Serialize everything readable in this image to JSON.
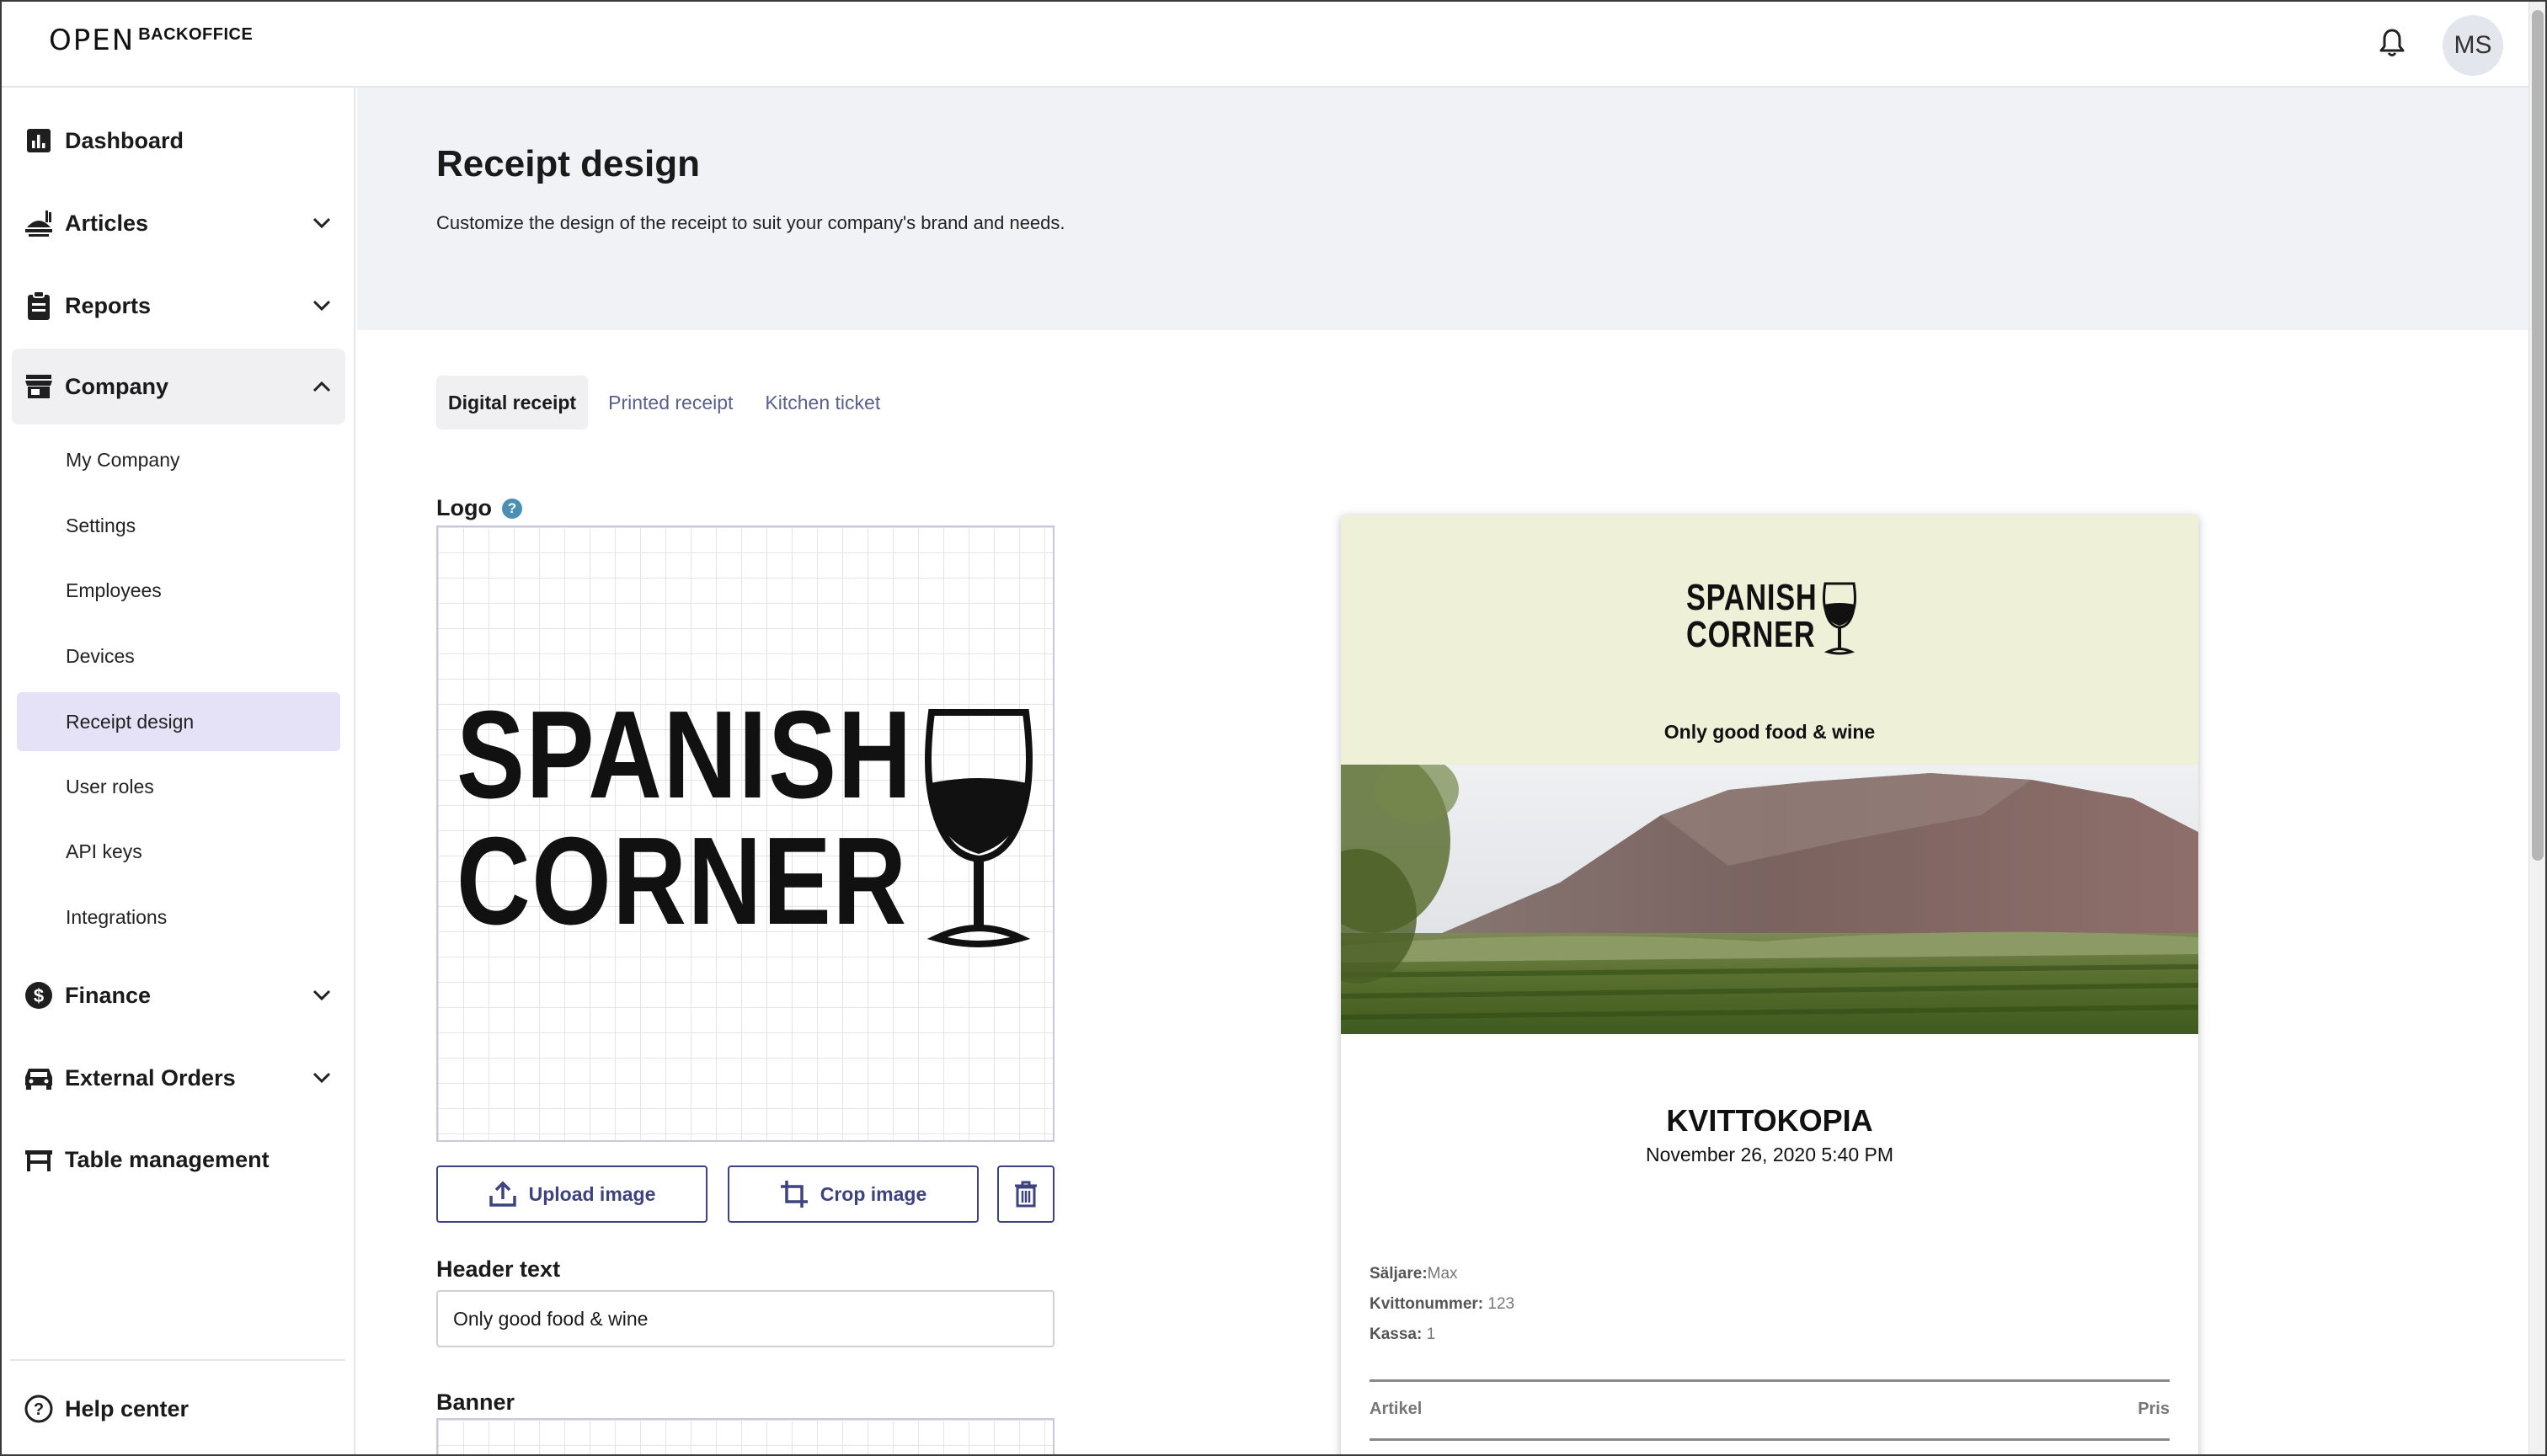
{
  "app": {
    "brand_main": "OPEN",
    "brand_sub": "BACKOFFICE",
    "user_initials": "MS"
  },
  "sidebar": {
    "items": [
      {
        "label": "Dashboard",
        "icon": "bar-chart-icon"
      },
      {
        "label": "Articles",
        "icon": "food-icon"
      },
      {
        "label": "Reports",
        "icon": "clipboard-icon"
      },
      {
        "label": "Company",
        "icon": "store-icon"
      },
      {
        "label": "Finance",
        "icon": "dollar-icon"
      },
      {
        "label": "External Orders",
        "icon": "car-icon"
      },
      {
        "label": "Table management",
        "icon": "table-icon"
      }
    ],
    "company_sub": [
      "My Company",
      "Settings",
      "Employees",
      "Devices",
      "Receipt design",
      "User roles",
      "API keys",
      "Integrations"
    ],
    "active_sub": "Receipt design",
    "help": "Help center"
  },
  "page": {
    "title": "Receipt design",
    "description": "Customize the design of the receipt to suit your company's brand and needs."
  },
  "tabs": [
    "Digital receipt",
    "Printed receipt",
    "Kitchen ticket"
  ],
  "active_tab": "Digital receipt",
  "form": {
    "logo_label": "Logo",
    "logo_help": "?",
    "logo_text_line1": "SPANISH",
    "logo_text_line2": "CORNER",
    "upload_label": "Upload image",
    "crop_label": "Crop image",
    "header_label": "Header text",
    "header_value": "Only good food & wine",
    "banner_label": "Banner"
  },
  "receipt": {
    "logo_line1": "SPANISH",
    "logo_line2": "CORNER",
    "tagline": "Only good food & wine",
    "title": "KVITTOKOPIA",
    "date": "November 26, 2020 5:40 PM",
    "seller_label": "Säljare:",
    "seller_value": "Max",
    "receipt_no_label": "Kvittonummer:",
    "receipt_no_value": "123",
    "register_label": "Kassa:",
    "register_value": "1",
    "col_article": "Artikel",
    "col_price": "Pris"
  },
  "colors": {
    "accent": "#3d4281",
    "active_nav": "#e5e2f8",
    "hero_bg": "#f1f2f6",
    "receipt_header_bg": "#eef0d8"
  }
}
